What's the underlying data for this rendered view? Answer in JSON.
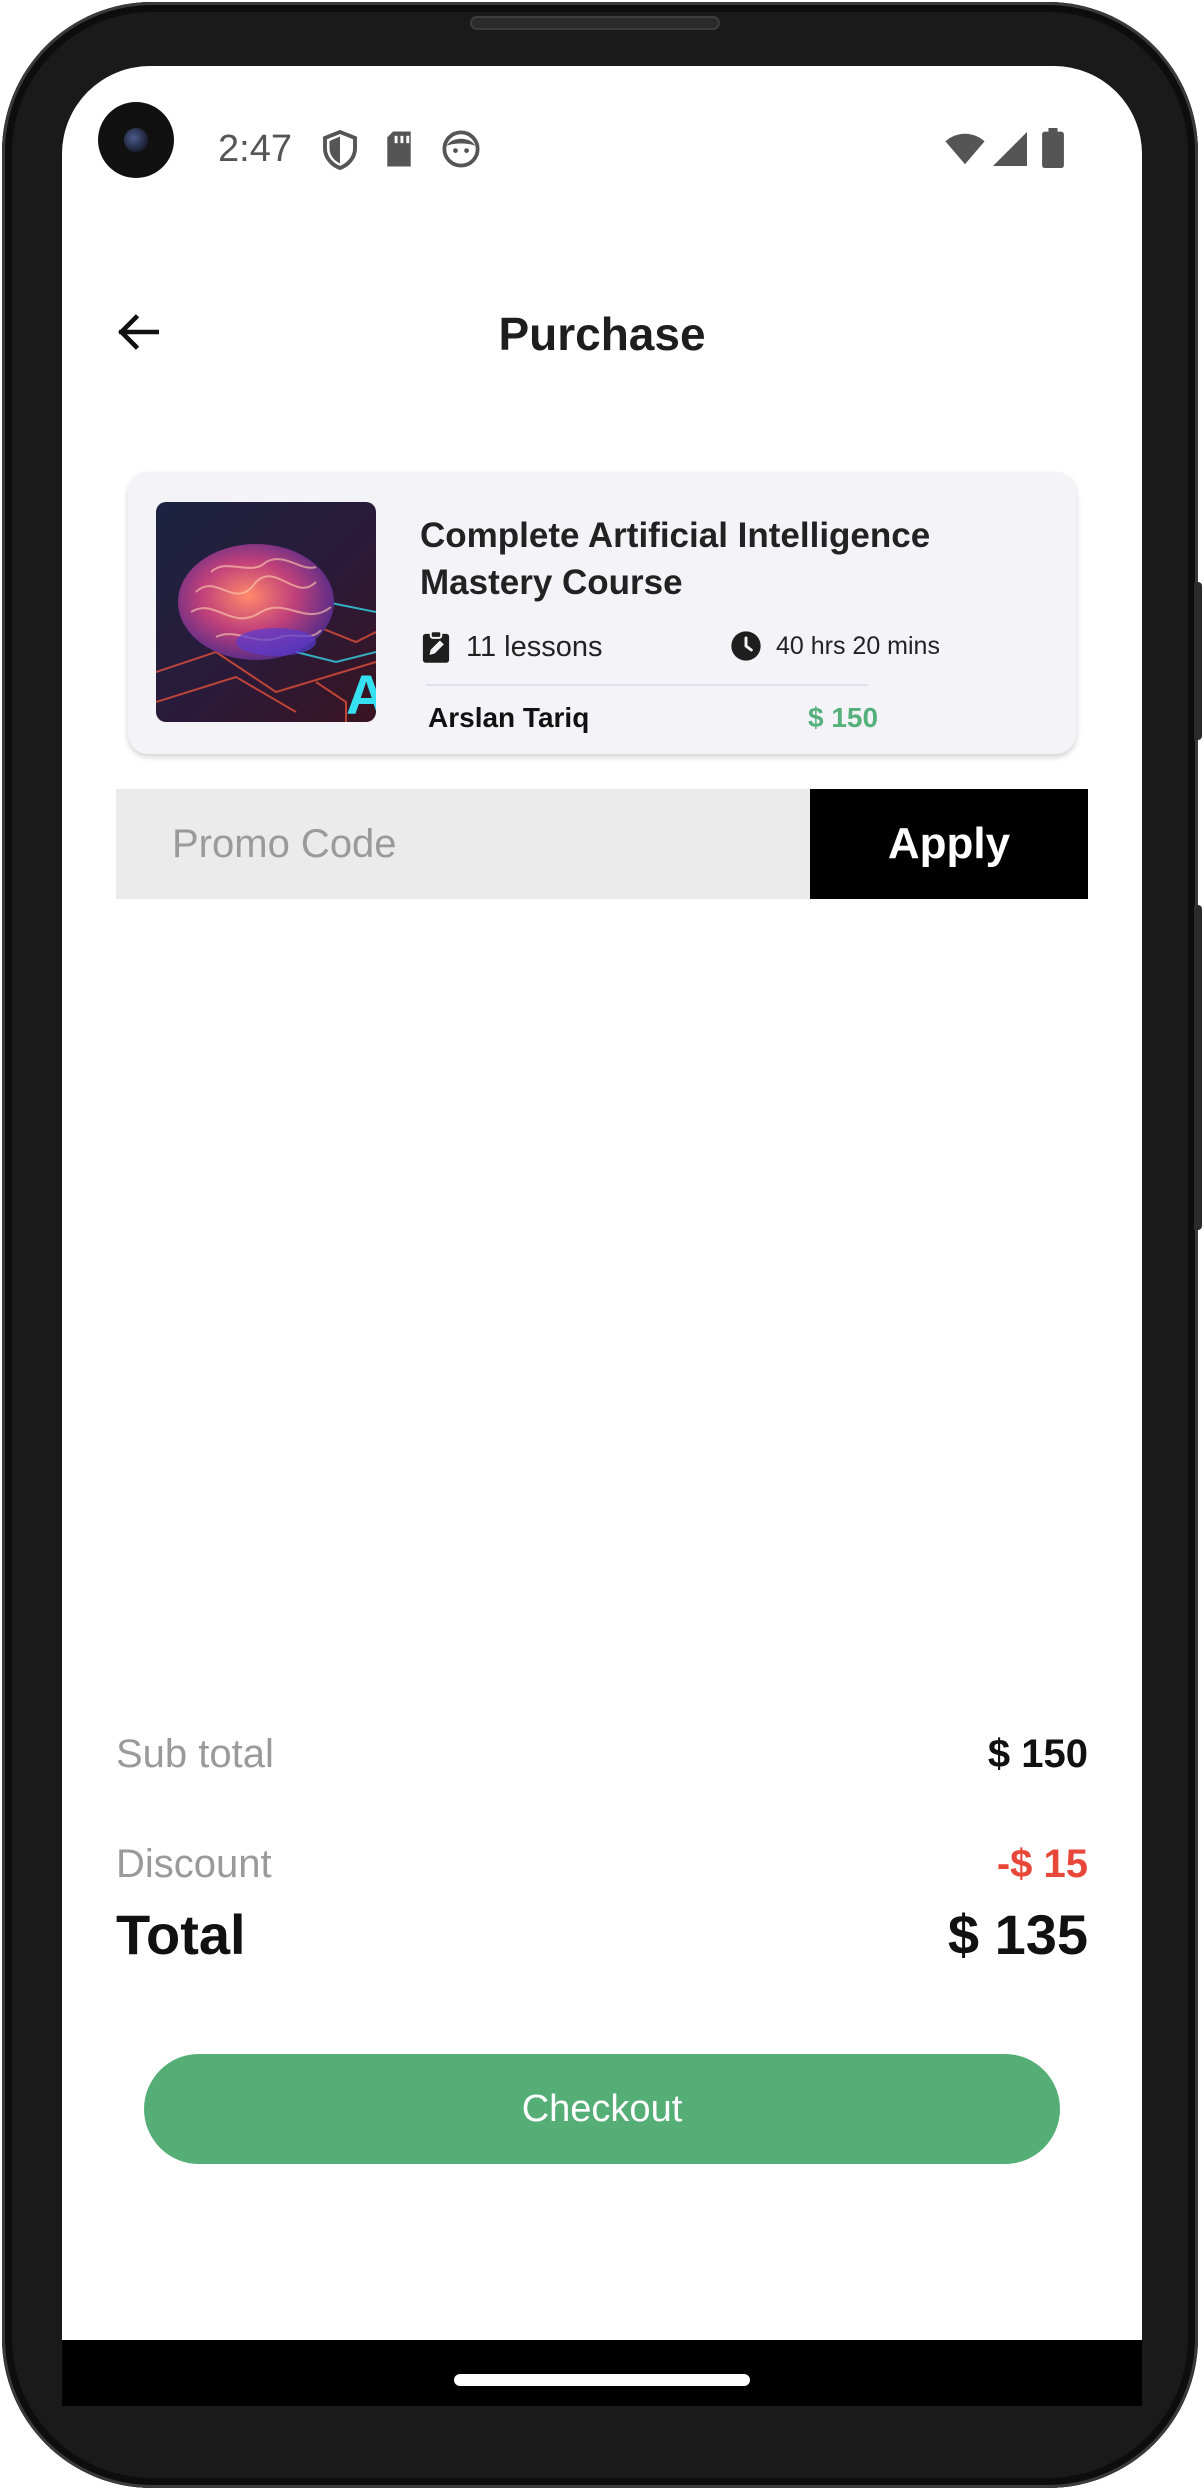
{
  "status_bar": {
    "time": "2:47",
    "icons": [
      "shield-icon",
      "sd-card-icon",
      "face-icon",
      "wifi-icon",
      "signal-icon",
      "battery-icon"
    ]
  },
  "header": {
    "title": "Purchase",
    "back_icon": "arrow-left-icon"
  },
  "course": {
    "title": "Complete Artificial Intelligence Mastery Course",
    "lessons": "11 lessons",
    "duration": "40 hrs 20 mins",
    "instructor": "Arslan Tariq",
    "price": "$ 150"
  },
  "promo": {
    "placeholder": "Promo Code",
    "apply_label": "Apply"
  },
  "summary": {
    "subtotal_label": "Sub total",
    "subtotal_value": "$ 150",
    "discount_label": "Discount",
    "discount_value": "-$ 15",
    "total_label": "Total",
    "total_value": "$ 135"
  },
  "checkout_label": "Checkout",
  "colors": {
    "accent_green": "#56ae77",
    "price_green": "#55b07c",
    "discount_red": "#e8473a",
    "apply_black": "#000000"
  }
}
